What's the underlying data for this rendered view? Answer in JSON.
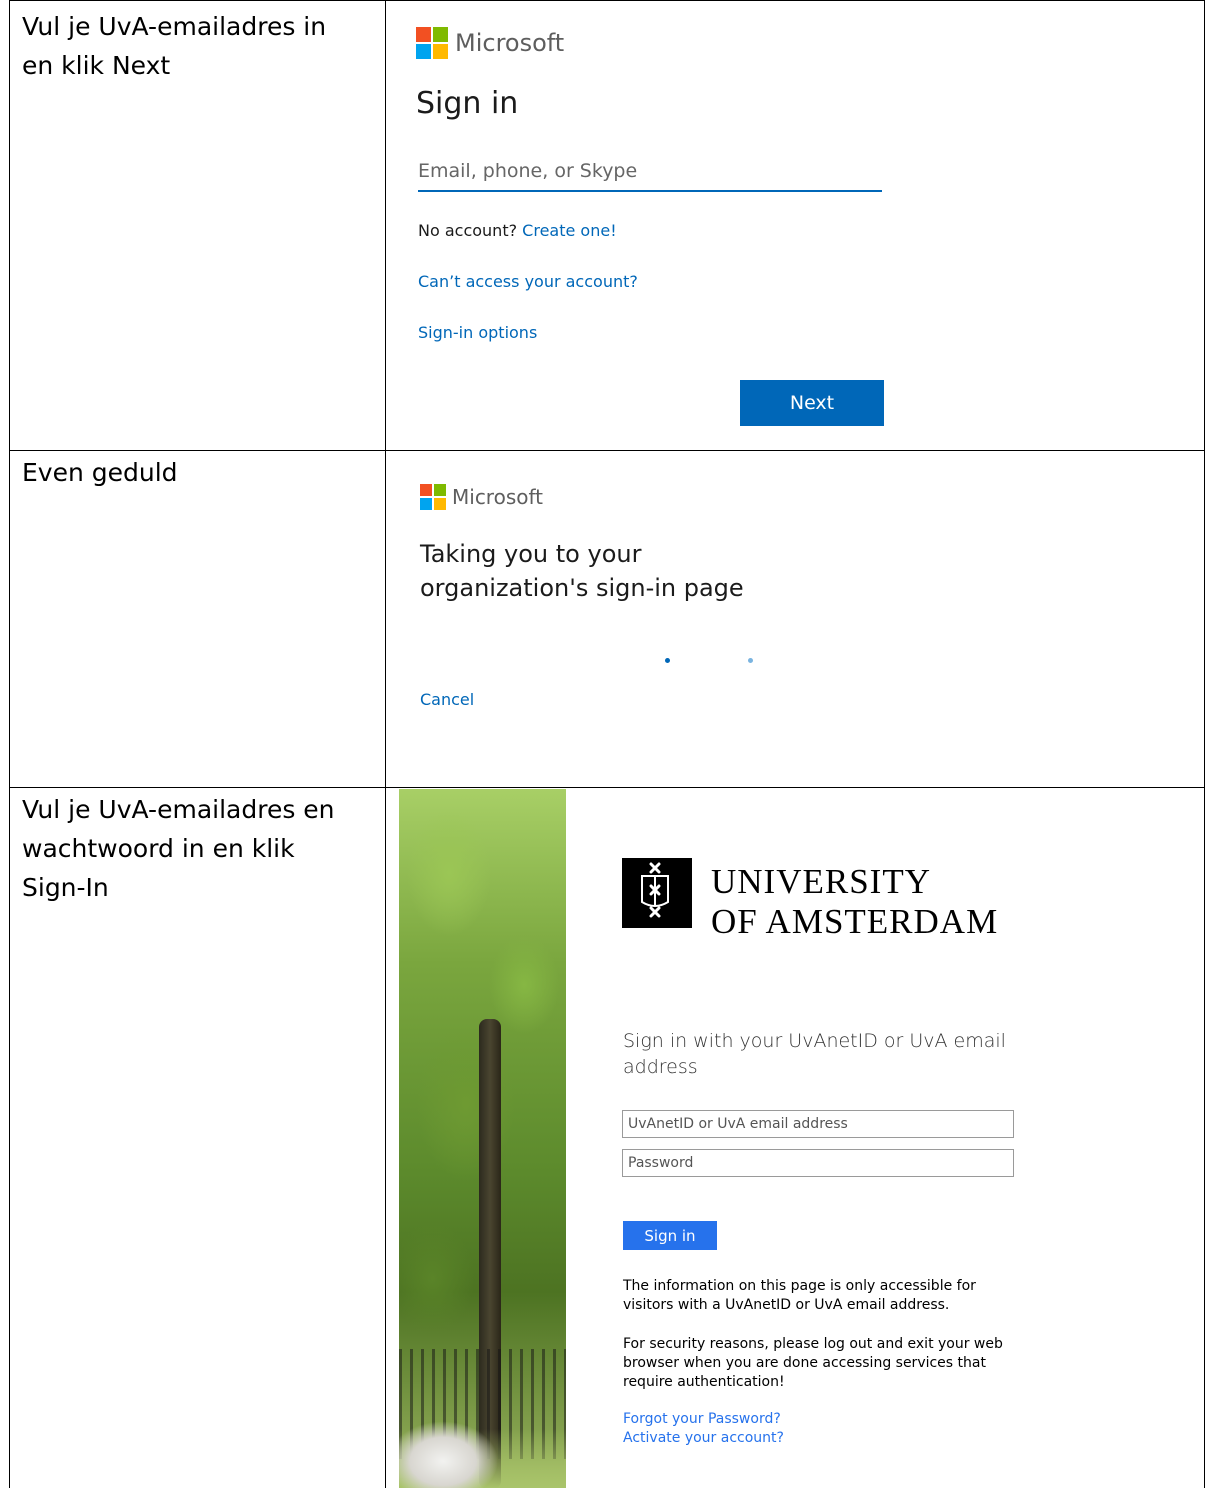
{
  "rows": [
    {
      "instruction_lines": [
        "Vul je UvA-emailadres in",
        "en klik Next"
      ],
      "brand": "Microsoft",
      "title": "Sign in",
      "email_placeholder": "Email, phone, or Skype",
      "no_account_text": "No account?",
      "create_link": "Create one!",
      "cant_access_link": "Can’t access your account?",
      "signin_options_link": "Sign-in options",
      "next_button": "Next"
    },
    {
      "instruction_lines": [
        "Even geduld"
      ],
      "brand": "Microsoft",
      "title_lines": [
        "Taking you to your",
        "organization's sign-in page"
      ],
      "cancel_link": "Cancel"
    },
    {
      "instruction_lines": [
        "Vul je UvA-emailadres en",
        "wachtwoord in en klik",
        "Sign-In"
      ],
      "university_lines": [
        "UNIVERSITY",
        "OF AMSTERDAM"
      ],
      "heading_lines": [
        "Sign in with your UvAnetID or UvA email",
        "address"
      ],
      "username_placeholder": "UvAnetID or UvA email address",
      "password_placeholder": "Password",
      "signin_button": "Sign in",
      "info_lines": [
        "The information on this page is only accessible for",
        "visitors with a UvAnetID or UvA email address."
      ],
      "security_lines": [
        "For security reasons, please log out and exit your web",
        "browser when you are done accessing services that",
        "require authentication!"
      ],
      "forgot_link": "Forgot your Password?",
      "activate_link": "Activate your account?"
    }
  ],
  "colors": {
    "ms_blue": "#0067b8",
    "uva_blue": "#2672ec",
    "ms_red": "#f25022",
    "ms_green": "#7fba00",
    "ms_blue_square": "#00a4ef",
    "ms_yellow": "#ffb900"
  }
}
